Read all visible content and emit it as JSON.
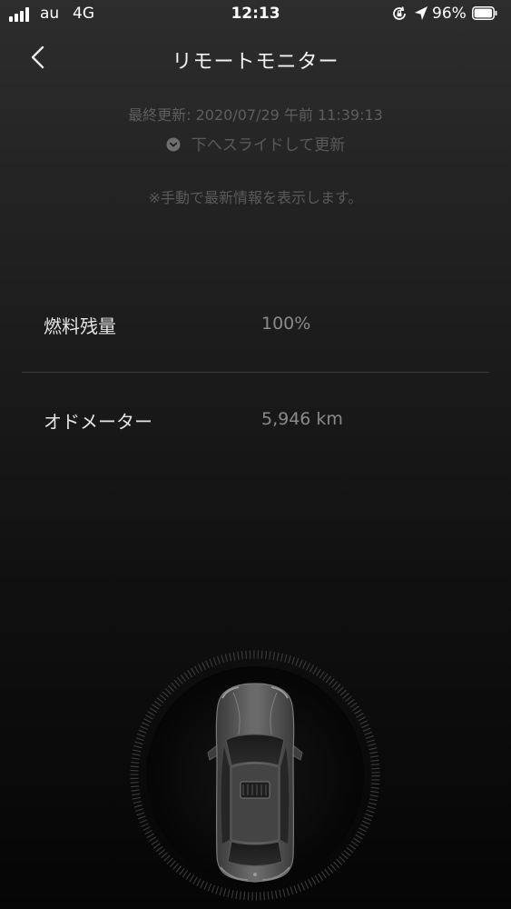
{
  "status_bar": {
    "carrier": "au",
    "network": "4G",
    "time": "12:13",
    "battery_percent": "96%"
  },
  "nav": {
    "title": "リモートモニター",
    "back_icon": "chevron-left-icon"
  },
  "update": {
    "last_updated": "最終更新: 2020/07/29 午前 11:39:13",
    "pull_hint": "下へスライドして更新",
    "pull_icon": "chevron-down-circle-icon",
    "manual_note": "※手動で最新情報を表示します。"
  },
  "rows": [
    {
      "label": "燃料残量",
      "value": "100%"
    },
    {
      "label": "オドメーター",
      "value": "5,946 km"
    }
  ],
  "colors": {
    "background_top": "#2d2d2d",
    "background_bottom": "#050505",
    "primary_text": "#e4e4e4",
    "secondary_text": "#8a8a8a",
    "muted_text": "#5a5a5a"
  }
}
